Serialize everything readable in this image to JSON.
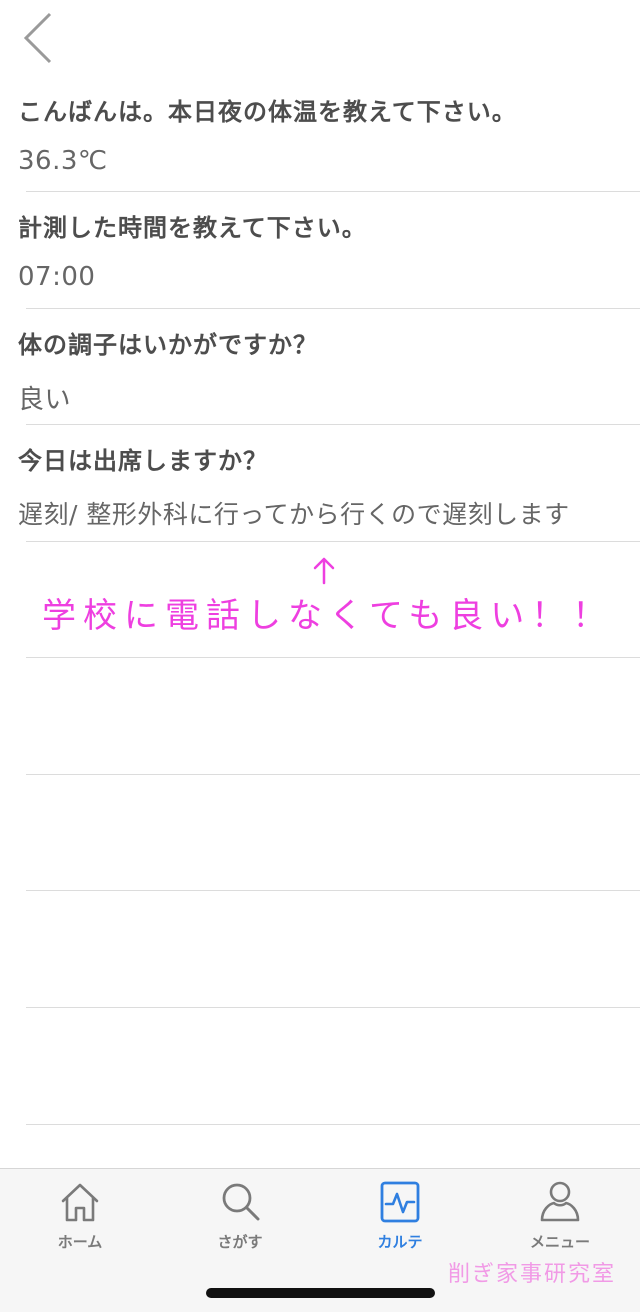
{
  "nav": {
    "back_icon": "chevron-left-icon"
  },
  "questions": [
    {
      "question": "こんばんは。本日夜の体温を教えて下さい。",
      "answer": "36.3℃"
    },
    {
      "question": "計測した時間を教えて下さい。",
      "answer": "07:00"
    },
    {
      "question": "体の調子はいかがですか？",
      "answer": "良い"
    },
    {
      "question": "今日は出席しますか？",
      "answer": "遅刻/ 整形外科に行ってから行くので遅刻します"
    }
  ],
  "annotation": {
    "arrow": "↑",
    "text": "学校に電話しなくても良い！！",
    "color": "#ee3fe0"
  },
  "tabbar": {
    "tabs": [
      {
        "label": "ホーム",
        "icon": "home-icon"
      },
      {
        "label": "さがす",
        "icon": "search-icon"
      },
      {
        "label": "カルテ",
        "icon": "chart-icon",
        "active": true
      },
      {
        "label": "メニュー",
        "icon": "person-icon"
      }
    ],
    "active_color": "#2f7fe0",
    "inactive_color": "#7a7a7a"
  },
  "watermark": "削ぎ家事研究室"
}
